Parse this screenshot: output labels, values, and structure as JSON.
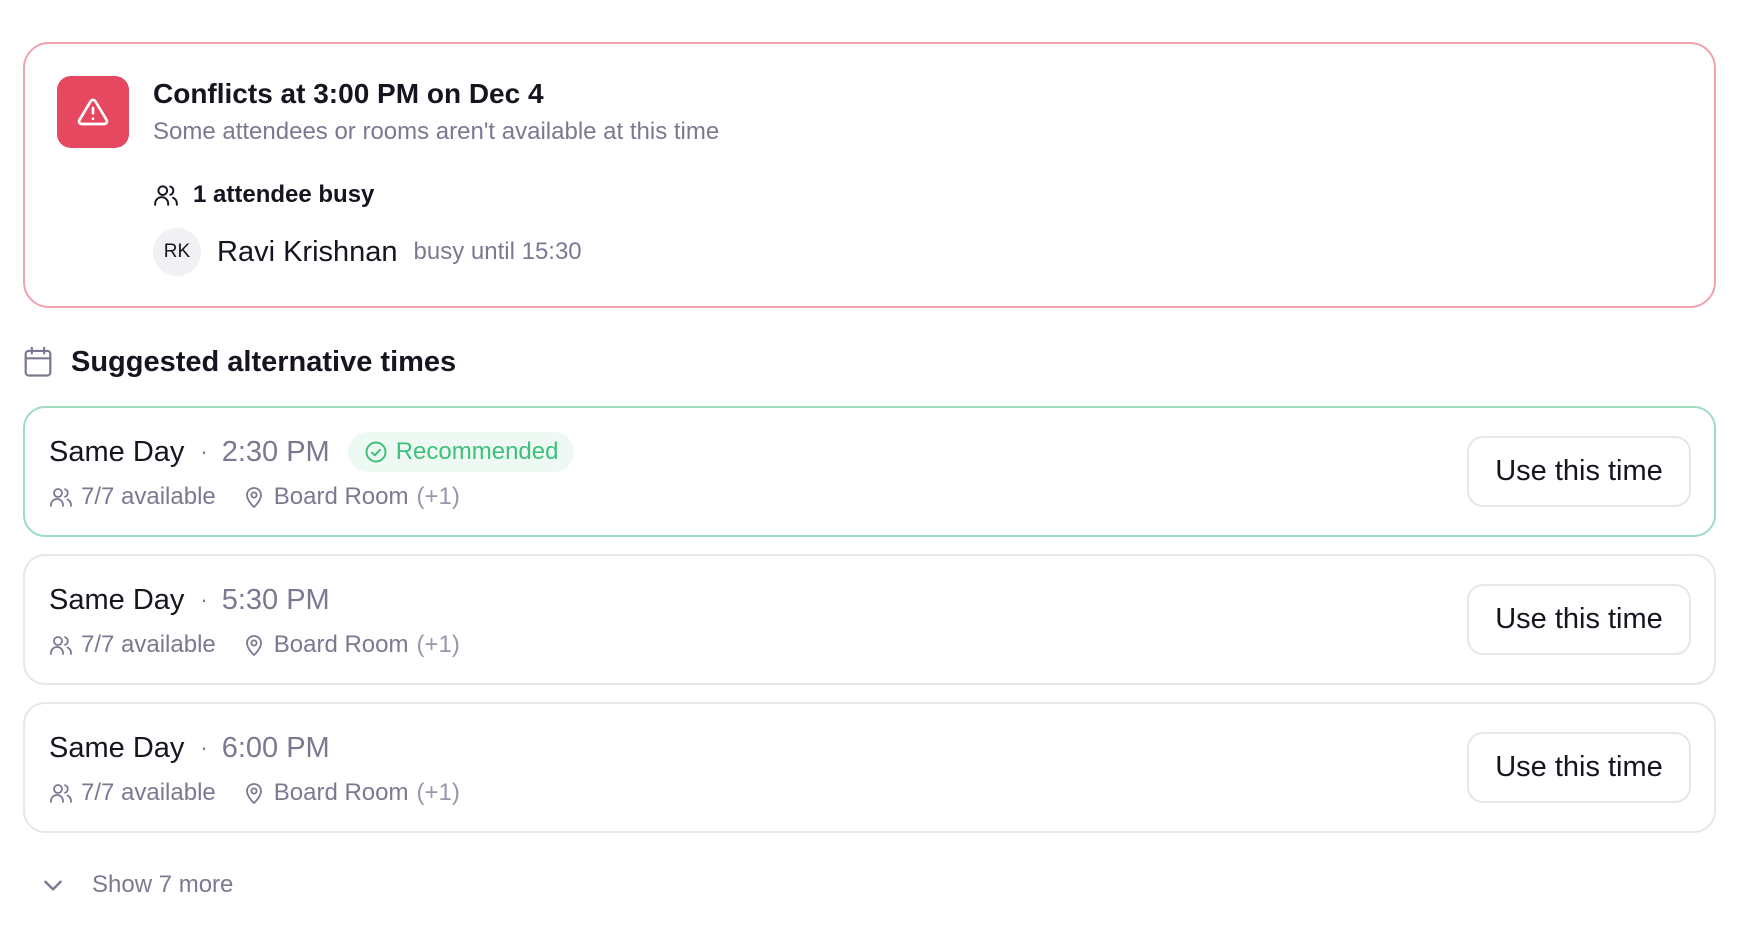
{
  "conflict": {
    "title": "Conflicts at 3:00 PM on Dec 4",
    "subtitle": "Some attendees or rooms aren't available at this time",
    "busy_label": "1 attendee busy",
    "people": [
      {
        "initials": "RK",
        "name": "Ravi Krishnan",
        "status": "busy until 15:30"
      }
    ],
    "icon": "warning-triangle-icon"
  },
  "suggestions": {
    "title": "Suggested alternative times",
    "icon": "calendar-icon",
    "items": [
      {
        "day": "Same Day",
        "separator": "·",
        "time": "2:30 PM",
        "badge": "Recommended",
        "availability": "7/7 available",
        "room": "Board Room",
        "room_extra": "(+1)",
        "button": "Use this time",
        "recommended": true
      },
      {
        "day": "Same Day",
        "separator": "·",
        "time": "5:30 PM",
        "availability": "7/7 available",
        "room": "Board Room",
        "room_extra": "(+1)",
        "button": "Use this time",
        "recommended": false
      },
      {
        "day": "Same Day",
        "separator": "·",
        "time": "6:00 PM",
        "availability": "7/7 available",
        "room": "Board Room",
        "room_extra": "(+1)",
        "button": "Use this time",
        "recommended": false
      }
    ],
    "show_more": "Show 7 more"
  },
  "colors": {
    "danger": "#e5485f",
    "danger_border": "#f1a2ad",
    "success": "#3fc07d",
    "success_border": "#9edcc0",
    "muted_text": "#7d7891"
  }
}
